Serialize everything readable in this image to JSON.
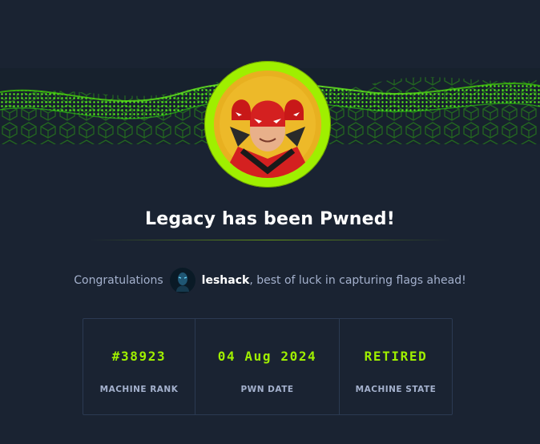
{
  "headline": "Legacy has been Pwned!",
  "congrats": {
    "prefix": "Congratulations",
    "username": "leshack",
    "suffix": ", best of luck in capturing flags ahead!"
  },
  "stats": [
    {
      "value": "#38923",
      "label": "MACHINE RANK"
    },
    {
      "value": "04 Aug 2024",
      "label": "PWN DATE"
    },
    {
      "value": "RETIRED",
      "label": "MACHINE STATE"
    }
  ],
  "colors": {
    "background": "#1a2332",
    "accent": "#9fef00",
    "muted_text": "#a4b1cd",
    "border": "#2b3a52"
  },
  "icons": {
    "machine_avatar": "red-masked-hacker-avatar",
    "user_avatar": "user-avatar"
  }
}
